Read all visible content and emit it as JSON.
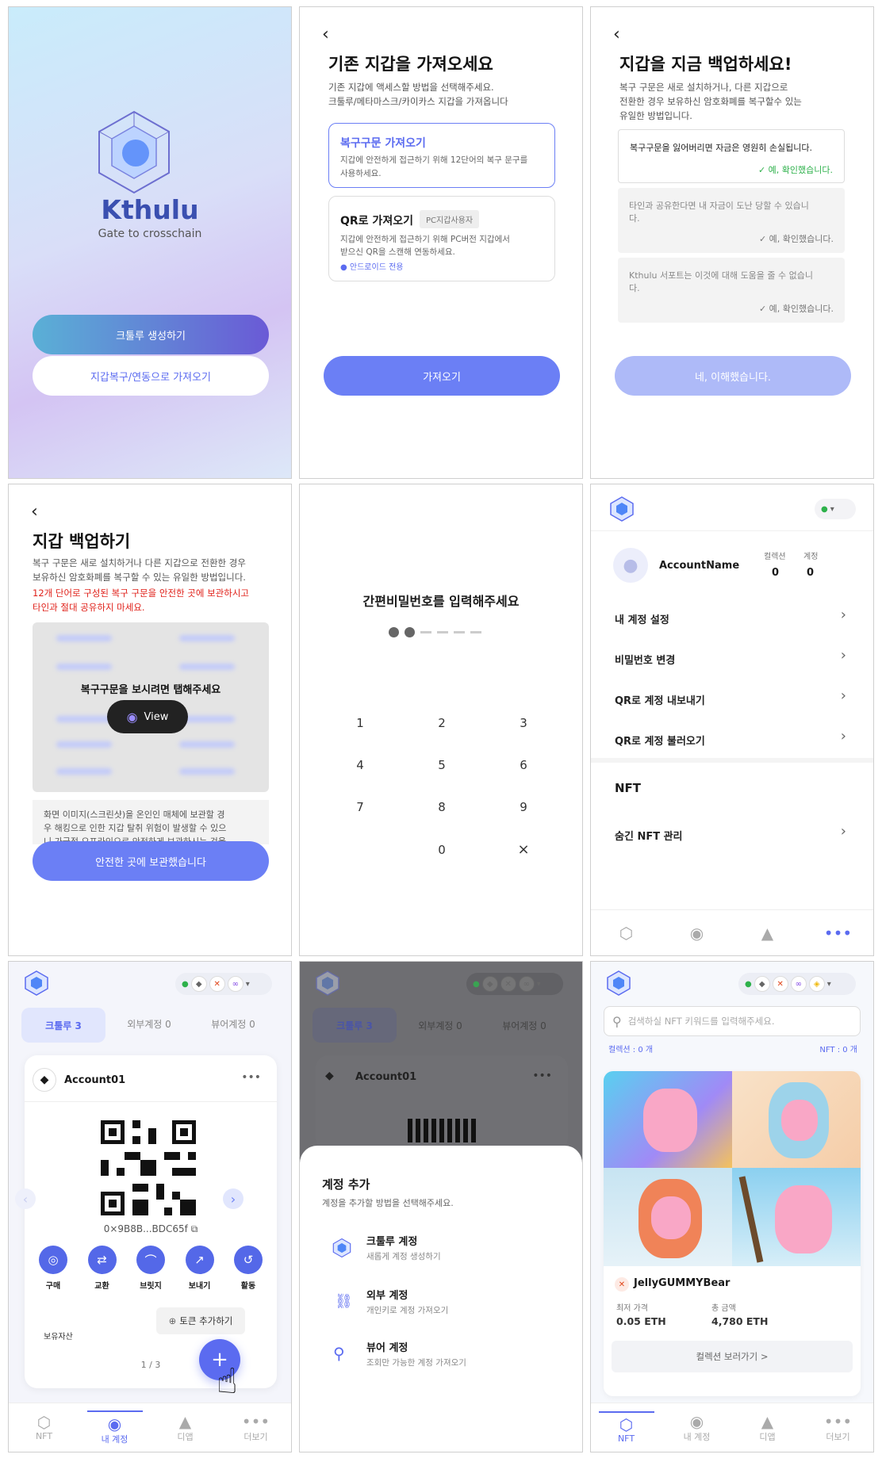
{
  "welcome": {
    "brand": "Kthulu",
    "tagline": "Gate to crosschain",
    "create_btn": "크툴루 생성하기",
    "import_btn": "지갑복구/연동으로 가져오기"
  },
  "import": {
    "title": "기존 지갑을 가져오세요",
    "desc1": "기존 지갑에 액세스할 방법을 선택해주세요.",
    "desc2": "크툴루/메타마스크/카이카스 지갑을 가져옵니다",
    "opt1_title": "복구구문 가져오기",
    "opt1_desc1": "지갑에 안전하게 접근하기 위해 12단어의 복구 문구를",
    "opt1_desc2": "사용하세요.",
    "opt2_title": "QR로 가져오기",
    "opt2_badge": "PC지갑사용자",
    "opt2_desc1": "지갑에 안전하게 접근하기 위해 PC버전 지갑에서",
    "opt2_desc2": "받으신 QR을 스캔해 연동하세요.",
    "opt2_note": "안드로이드 전용",
    "btn": "가져오기"
  },
  "backup_warn": {
    "title": "지갑을 지금 백업하세요!",
    "desc1": "복구 구문은 새로 설치하거나, 다른 지갑으로",
    "desc2": "전환한 경우 보유하신 암호화폐를 복구할수 있는",
    "desc3": "유일한 방법입니다.",
    "c1": "복구구문을 잃어버리면 자금은 영원히 손실됩니다.",
    "c2a": "타인과 공유한다면 내 자금이 도난 당할 수 있습니",
    "c2b": "다.",
    "c3a": "Kthulu 서포트는 이것에 대해 도움을 줄 수 없습니",
    "c3b": "다.",
    "confirm": "예, 확인했습니다.",
    "btn": "네, 이해했습니다."
  },
  "backup": {
    "title": "지갑 백업하기",
    "desc1": "복구 구문은 새로 설치하거나 다른 지갑으로 전환한 경우",
    "desc2": "보유하신 암호화폐를 복구할 수 있는 유일한 방법입니다.",
    "warn1": "12개 단어로 구성된 복구 구문을 안전한 곳에 보관하시고",
    "warn2": "타인과 절대 공유하지 마세요.",
    "tap": "복구구문을 보시려면 탭해주세요",
    "view": "View",
    "note1": "화면 이미지(스크린샷)을 온인인 매체에 보관할 경",
    "note2": "우 해킹으로 인한 지갑 탈취 위험이 발생할 수 있으",
    "note3": "니 가급적 오프라인으로 안전하게 보관하시는 것을",
    "btn": "안전한 곳에 보관했습니다"
  },
  "pin": {
    "title": "간편비밀번호를 입력해주세요",
    "keys": [
      "1",
      "2",
      "3",
      "4",
      "5",
      "6",
      "7",
      "8",
      "9",
      "0",
      "×"
    ]
  },
  "settings": {
    "account_name": "AccountName",
    "collection_label": "컬렉션",
    "collection_val": "0",
    "account_label": "계정",
    "account_val": "0",
    "items": [
      "내 계정 설정",
      "비밀번호 변경",
      "QR로 계정 내보내기",
      "QR로 계정 불러오기"
    ],
    "nft_header": "NFT",
    "nft_item": "숨긴 NFT 관리"
  },
  "wallet": {
    "tabs": [
      "크툴루 3",
      "외부계정 0",
      "뷰어계정 0"
    ],
    "account": "Account01",
    "address": "0×9B8B...BDC65f",
    "actions": [
      "구매",
      "교환",
      "브릿지",
      "보내기",
      "활동"
    ],
    "add_token": "토큰 추가하기",
    "assets": "보유자산",
    "page": "1 / 3",
    "nav": [
      "NFT",
      "내 계정",
      "디앱",
      "더보기"
    ]
  },
  "add_sheet": {
    "title": "계정 추가",
    "desc": "계정을 추가할 방법을 선택해주세요.",
    "o1_title": "크툴루 계정",
    "o1_desc": "새롭게 계정 생성하기",
    "o2_title": "외부 계정",
    "o2_desc": "개인키로 계정 가져오기",
    "o3_title": "뷰어 계정",
    "o3_desc": "조회만 가능한 계정 가져오기"
  },
  "nft": {
    "search_placeholder": "검색하실 NFT 키워드를 입력해주세요.",
    "collection_count": "컬렉션 : 0 개",
    "nft_count": "NFT : 0 개",
    "collection_name": "JellyGUMMYBear",
    "floor_label": "최저 가격",
    "floor_val": "0.05 ETH",
    "total_label": "총 금액",
    "total_val": "4,780 ETH",
    "view_btn": "컬렉션 보러가기 >",
    "nav": [
      "NFT",
      "내 계정",
      "디앱",
      "더보기"
    ]
  },
  "colors": {
    "primary": "#6b7ff5",
    "accent_green": "#2eb14b",
    "warn_red": "#e0221b"
  }
}
